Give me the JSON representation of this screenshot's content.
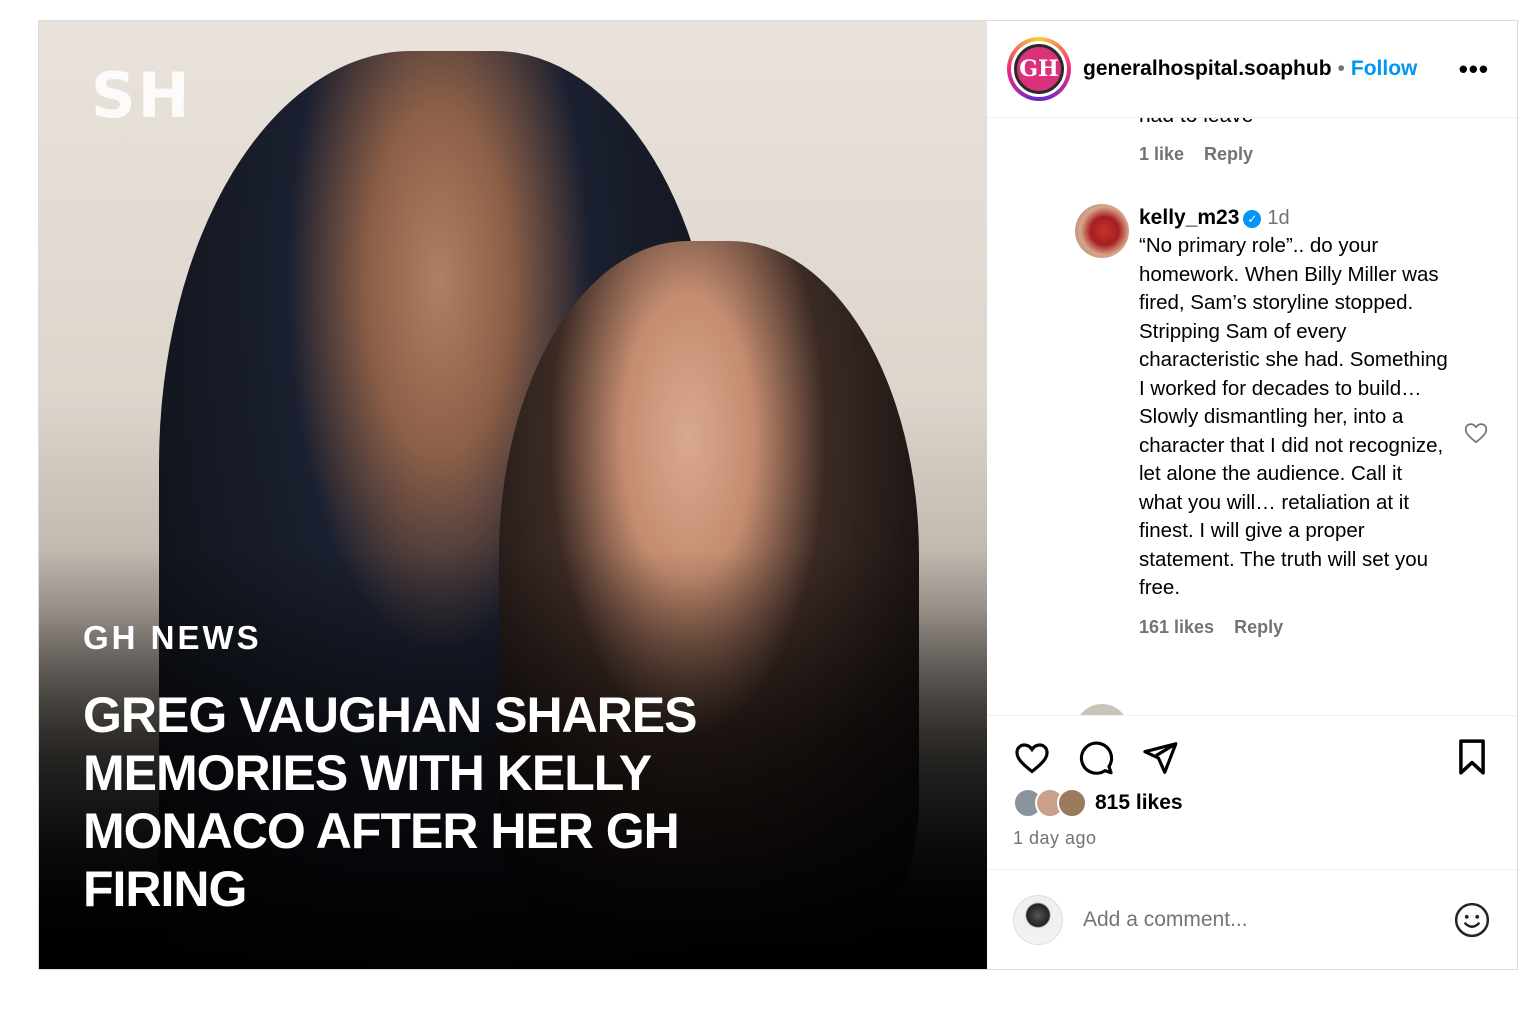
{
  "media": {
    "brand_mark": "SH",
    "overline": "GH NEWS",
    "headline": "GREG VAUGHAN SHARES MEMORIES WITH KELLY MONACO AFTER HER GH FIRING"
  },
  "header": {
    "account_name": "generalhospital.soaphub",
    "separator": "•",
    "follow_label": "Follow",
    "more_label": "•••",
    "avatar_text": "GH"
  },
  "comments": {
    "previous": {
      "clipped_text": "had to leave",
      "likes": "1 like",
      "reply_label": "Reply"
    },
    "main": {
      "username": "kelly_m23",
      "verified_mark": "✓",
      "time": "1d",
      "text": "“No primary role”.. do your homework. When Billy Miller was fired, Sam’s storyline stopped. Stripping Sam of every characteristic she had. Something I worked for decades to build… Slowly dismantling her, into a character that I did not recognize, let alone the audience. Call it what you will… retaliation at it finest. I will give a proper statement. The truth will set you free.",
      "likes": "161 likes",
      "reply_label": "Reply"
    }
  },
  "actions": {
    "likes": "815 likes",
    "posted": "1 day ago"
  },
  "comment_input": {
    "placeholder": "Add a comment..."
  },
  "colors": {
    "accent_blue": "#0095f6",
    "secondary_text": "#737373",
    "border": "#dbdbdb"
  },
  "icons": [
    "heart-icon",
    "comment-icon",
    "share-icon",
    "bookmark-icon",
    "emoji-icon",
    "verified-icon",
    "more-icon"
  ]
}
